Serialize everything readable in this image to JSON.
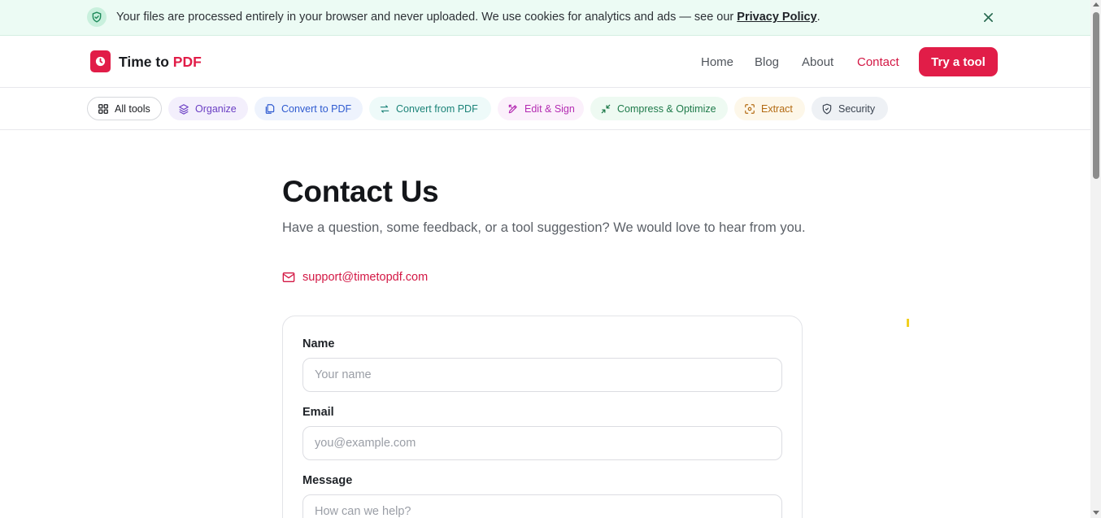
{
  "notice": {
    "text": "Your files are processed entirely in your browser and never uploaded. We use cookies for analytics and ads — see our ",
    "link_label": "Privacy Policy",
    "suffix": "."
  },
  "header": {
    "logo_main": "Time to ",
    "logo_accent": "PDF",
    "nav": [
      "Home",
      "Blog",
      "About",
      "Contact"
    ],
    "active_nav": "Contact",
    "cta_label": "Try a tool"
  },
  "categories": [
    {
      "label": "All tools",
      "icon": "grid-icon"
    },
    {
      "label": "Organize",
      "icon": "layers-icon"
    },
    {
      "label": "Convert to PDF",
      "icon": "files-icon"
    },
    {
      "label": "Convert from PDF",
      "icon": "swap-icon"
    },
    {
      "label": "Edit & Sign",
      "icon": "pen-tool-icon"
    },
    {
      "label": "Compress & Optimize",
      "icon": "shrink-icon"
    },
    {
      "label": "Extract",
      "icon": "scan-icon"
    },
    {
      "label": "Security",
      "icon": "shield-icon"
    }
  ],
  "main": {
    "title": "Contact Us",
    "subtitle": "Have a question, some feedback, or a tool suggestion? We would love to hear from you.",
    "email": "support@timetopdf.com"
  },
  "form": {
    "name_label": "Name",
    "name_placeholder": "Your name",
    "email_label": "Email",
    "email_placeholder": "you@example.com",
    "message_label": "Message",
    "message_placeholder": "How can we help?"
  },
  "colors": {
    "brand": "#e11d48",
    "notice_bg": "#ecfbf4"
  }
}
